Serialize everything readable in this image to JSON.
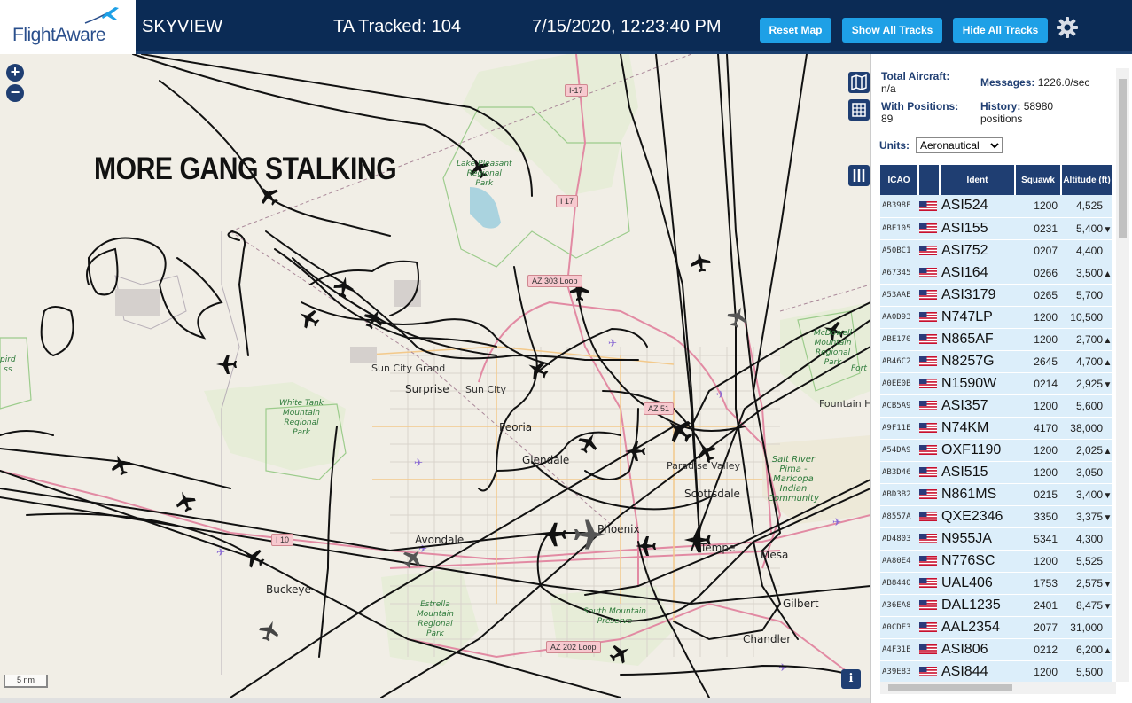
{
  "header": {
    "logo_text": "FlightAware",
    "app_title": "SKYVIEW",
    "ta_tracked": "TA Tracked: 104",
    "datetime": "7/15/2020, 12:23:40 PM",
    "reset_map_label": "Reset Map",
    "show_all_label": "Show All Tracks",
    "hide_all_label": "Hide All Tracks",
    "settings_icon": "gear-icon"
  },
  "map": {
    "overlay_text": "MORE GANG STALKING",
    "scale_label": "5 nm",
    "info_label": "i",
    "places": {
      "sun_city_grand": "Sun City Grand",
      "surprise": "Surprise",
      "sun_city": "Sun City",
      "peoria": "Peoria",
      "glendale": "Glendale",
      "paradise_valley": "Paradise Valley",
      "scottsdale": "Scottsdale",
      "phoenix": "Phoenix",
      "tempe": "Tempe",
      "mesa": "Mesa",
      "gilbert": "Gilbert",
      "chandler": "Chandler",
      "avondale": "Avondale",
      "buckeye": "Buckeye",
      "fountain_hills": "Fountain Hil",
      "fort": "Fort"
    },
    "parks": {
      "lake_pleasant": "Lake Pleasant\nRegional\nPark",
      "white_tank": "White Tank\nMountain\nRegional\nPark",
      "estrella": "Estrella\nMountain\nRegional\nPark",
      "south_mountain": "South Mountain\nPreserve",
      "mcdowell": "McDowell\nMountain\nRegional\nPark",
      "salt_river": "Salt River\nPima -\nMaricopa\nIndian\nCommunity",
      "hassayampa": "pird\nss"
    },
    "highways": {
      "i17_north": "I-17",
      "i17": "I 17",
      "az303": "AZ 303 Loop",
      "az51": "AZ 51",
      "i10": "I 10",
      "az202": "AZ 202 Loop"
    }
  },
  "sidebar": {
    "total_aircraft_label": "Total Aircraft:",
    "total_aircraft_value": "n/a",
    "with_positions_label": "With Positions:",
    "with_positions_value": "89",
    "messages_label": "Messages:",
    "messages_value": "1226.0/sec",
    "history_label": "History:",
    "history_value": "58980",
    "history_unit": "positions",
    "units_label": "Units:",
    "units_value": "Aeronautical",
    "columns": [
      "ICAO",
      "",
      "Ident",
      "Squawk",
      "Altitude (ft)"
    ],
    "rows": [
      {
        "icao": "AB398F",
        "ident": "ASI524",
        "squawk": "1200",
        "altitude": "4,525",
        "trend": ""
      },
      {
        "icao": "ABE105",
        "ident": "ASI155",
        "squawk": "0231",
        "altitude": "5,400",
        "trend": "▼"
      },
      {
        "icao": "A50BC1",
        "ident": "ASI752",
        "squawk": "0207",
        "altitude": "4,400",
        "trend": ""
      },
      {
        "icao": "A67345",
        "ident": "ASI164",
        "squawk": "0266",
        "altitude": "3,500",
        "trend": "▲"
      },
      {
        "icao": "A53AAE",
        "ident": "ASI3179",
        "squawk": "0265",
        "altitude": "5,700",
        "trend": ""
      },
      {
        "icao": "AA0D93",
        "ident": "N747LP",
        "squawk": "1200",
        "altitude": "10,500",
        "trend": ""
      },
      {
        "icao": "ABE170",
        "ident": "N865AF",
        "squawk": "1200",
        "altitude": "2,700",
        "trend": "▲"
      },
      {
        "icao": "AB46C2",
        "ident": "N8257G",
        "squawk": "2645",
        "altitude": "4,700",
        "trend": "▲"
      },
      {
        "icao": "A0EE0B",
        "ident": "N1590W",
        "squawk": "0214",
        "altitude": "2,925",
        "trend": "▼"
      },
      {
        "icao": "ACB5A9",
        "ident": "ASI357",
        "squawk": "1200",
        "altitude": "5,600",
        "trend": ""
      },
      {
        "icao": "A9F11E",
        "ident": "N74KM",
        "squawk": "4170",
        "altitude": "38,000",
        "trend": ""
      },
      {
        "icao": "A54DA9",
        "ident": "OXF1190",
        "squawk": "1200",
        "altitude": "2,025",
        "trend": "▲"
      },
      {
        "icao": "AB3D46",
        "ident": "ASI515",
        "squawk": "1200",
        "altitude": "3,050",
        "trend": ""
      },
      {
        "icao": "ABD3B2",
        "ident": "N861MS",
        "squawk": "0215",
        "altitude": "3,400",
        "trend": "▼"
      },
      {
        "icao": "A8557A",
        "ident": "QXE2346",
        "squawk": "3350",
        "altitude": "3,375",
        "trend": "▼"
      },
      {
        "icao": "AD4803",
        "ident": "N955JA",
        "squawk": "5341",
        "altitude": "4,300",
        "trend": ""
      },
      {
        "icao": "AA80E4",
        "ident": "N776SC",
        "squawk": "1200",
        "altitude": "5,525",
        "trend": ""
      },
      {
        "icao": "AB8440",
        "ident": "UAL406",
        "squawk": "1753",
        "altitude": "2,575",
        "trend": "▼"
      },
      {
        "icao": "A36EA8",
        "ident": "DAL1235",
        "squawk": "2401",
        "altitude": "8,475",
        "trend": "▼"
      },
      {
        "icao": "A0CDF3",
        "ident": "AAL2354",
        "squawk": "2077",
        "altitude": "31,000",
        "trend": ""
      },
      {
        "icao": "A4F31E",
        "ident": "ASI806",
        "squawk": "0212",
        "altitude": "6,200",
        "trend": "▲"
      },
      {
        "icao": "A39E83",
        "ident": "ASI844",
        "squawk": "1200",
        "altitude": "5,500",
        "trend": ""
      }
    ]
  },
  "colors": {
    "header_bg": "#0b2b55",
    "button_bg": "#1ea0e6",
    "table_header": "#1f3e72",
    "row_bg": "#dceefa",
    "map_bg": "#efece4",
    "track": "#111111"
  }
}
